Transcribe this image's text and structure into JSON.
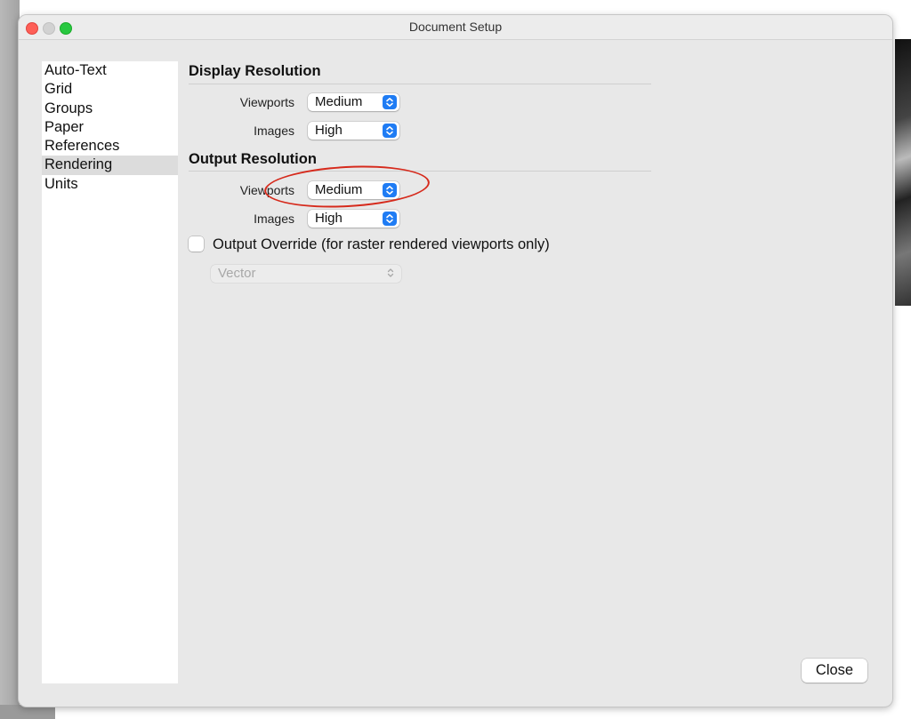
{
  "window": {
    "title": "Document Setup"
  },
  "sidebar": {
    "items": [
      {
        "label": "Auto-Text"
      },
      {
        "label": "Grid"
      },
      {
        "label": "Groups"
      },
      {
        "label": "Paper"
      },
      {
        "label": "References"
      },
      {
        "label": "Rendering",
        "selected": true
      },
      {
        "label": "Units"
      }
    ]
  },
  "display_resolution": {
    "title": "Display Resolution",
    "viewports_label": "Viewports",
    "viewports_value": "Medium",
    "images_label": "Images",
    "images_value": "High"
  },
  "output_resolution": {
    "title": "Output Resolution",
    "viewports_label": "Viewports",
    "viewports_value": "Medium",
    "images_label": "Images",
    "images_value": "High"
  },
  "output_override": {
    "label": "Output Override (for raster rendered viewports only)",
    "checked": false,
    "mode_value": "Vector"
  },
  "buttons": {
    "close_label": "Close"
  },
  "colors": {
    "accent": "#1f7cf4",
    "annotation": "#d62a1c",
    "close_light": "#fe5f57",
    "maximize_light": "#28c840"
  }
}
